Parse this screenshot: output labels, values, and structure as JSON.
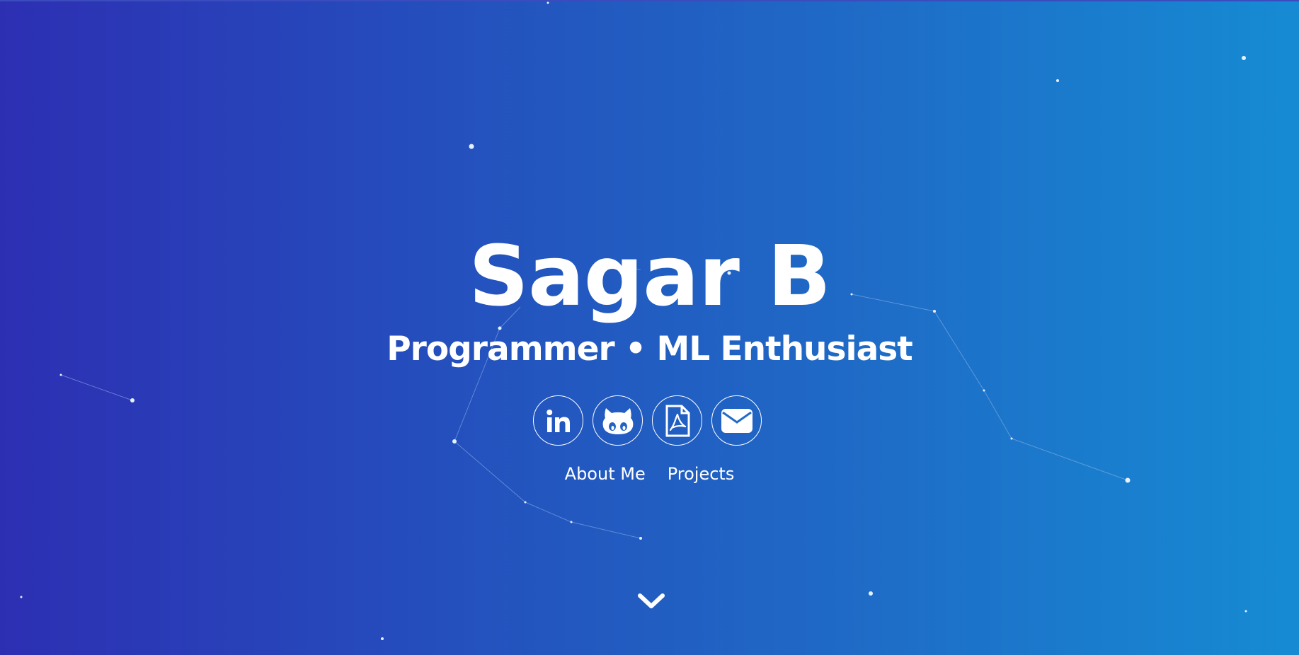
{
  "hero": {
    "name": "Sagar B",
    "tagline": "Programmer • ML Enthusiast"
  },
  "social": [
    {
      "name": "linkedin-icon",
      "label": "LinkedIn"
    },
    {
      "name": "github-icon",
      "label": "GitHub"
    },
    {
      "name": "pdf-icon",
      "label": "Resume"
    },
    {
      "name": "envelope-icon",
      "label": "Email"
    }
  ],
  "nav": {
    "about_label": "About Me",
    "projects_label": "Projects"
  },
  "icons": {
    "scroll": "chevron-down-icon"
  },
  "colors": {
    "gradient_start": "#2d2fb3",
    "gradient_end": "#168bd3",
    "text": "#ffffff"
  }
}
